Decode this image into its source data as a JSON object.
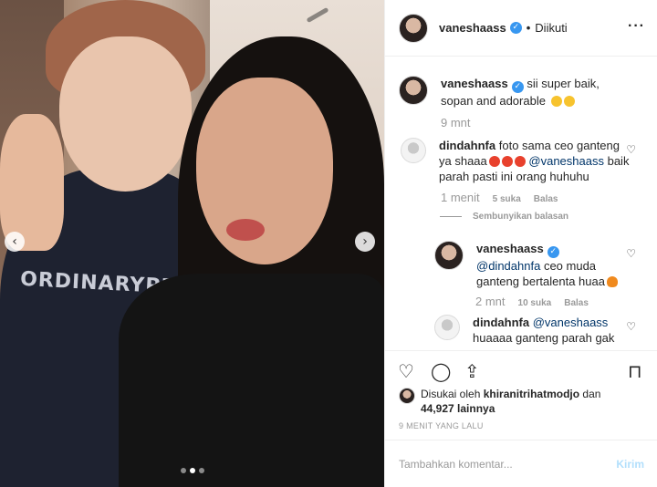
{
  "header": {
    "username": "vaneshaass",
    "separator": "•",
    "follow_status": "Diikuti",
    "more_icon": "ellipsis-icon"
  },
  "caption": {
    "username": "vaneshaass",
    "text": "sii super baik, sopan and adorable",
    "time": "9 mnt"
  },
  "comments": [
    {
      "username": "dindahnfa",
      "line1": "foto sama ceo ganteng ya shaaa",
      "mention": "@vaneshaass",
      "line2": "baik parah pasti ini orang huhuhu",
      "time": "1 menit",
      "likes": "5 suka",
      "reply": "Balas"
    }
  ],
  "hide_replies": "Sembunyikan balasan",
  "replies": [
    {
      "username": "vaneshaass",
      "mention": "@dindahnfa",
      "text": "ceo muda ganteng bertalenta huaa",
      "time": "2 mnt",
      "likes": "10 suka",
      "reply": "Balas"
    },
    {
      "username": "dindahnfa",
      "mention": "@vaneshaass",
      "text": "huaaaa ganteng parah gak"
    }
  ],
  "photo": {
    "shirt_text": "ORDINARYPEOPLE"
  },
  "likes": {
    "prefix": "Disukai oleh",
    "user": "khiranitrihatmodjo",
    "joiner": "dan",
    "count": "44,927",
    "suffix": "lainnya"
  },
  "timestamp": "9 MENIT YANG LALU",
  "add_comment": {
    "placeholder": "Tambahkan komentar...",
    "post_label": "Kirim"
  }
}
